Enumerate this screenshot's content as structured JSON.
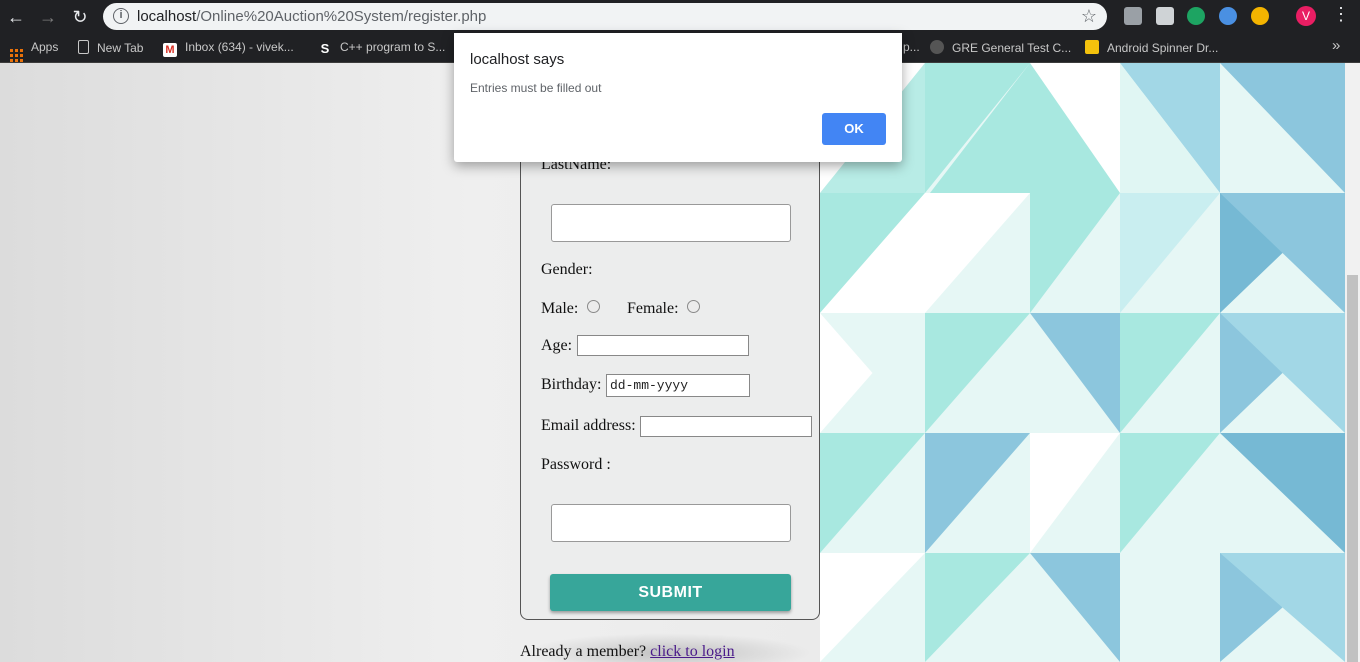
{
  "browser": {
    "url_host": "localhost",
    "url_path": "/Online%20Auction%20System/register.php",
    "avatar_letter": "V",
    "bookmarks": [
      {
        "label": "Apps"
      },
      {
        "label": "New Tab"
      },
      {
        "label": "Inbox (634) - vivek..."
      },
      {
        "label": "C++ program to S..."
      },
      {
        "label": "p..."
      },
      {
        "label": "GRE General Test C..."
      },
      {
        "label": "Android Spinner Dr..."
      }
    ],
    "more_bookmarks": "»"
  },
  "form": {
    "lastname_label": "LastName:",
    "gender_label": "Gender:",
    "male_label": "Male:",
    "female_label": "Female:",
    "age_label": "Age:",
    "birthday_label": "Birthday:",
    "birthday_placeholder": "dd-mm-yyyy",
    "email_label": "Email address:",
    "password_label": "Password :",
    "submit_label": "SUBMIT"
  },
  "footer": {
    "already_text": "Already a member?",
    "login_link": "click to login"
  },
  "dialog": {
    "title": "localhost says",
    "message": "Entries must be filled out",
    "ok_label": "OK"
  },
  "colors": {
    "submit": "#37a69a",
    "dialog_ok": "#4285f4",
    "pattern_teal": "#a8e8e0",
    "pattern_blue": "#8cc6dd"
  }
}
